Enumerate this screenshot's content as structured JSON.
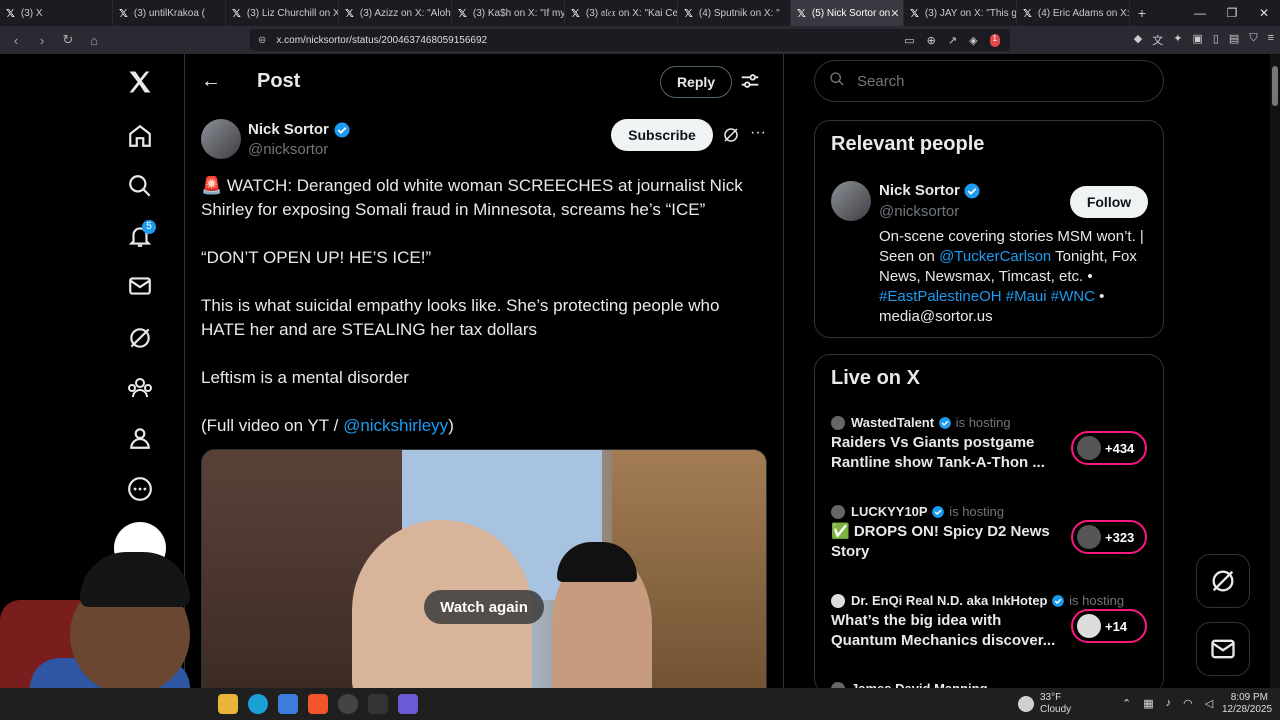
{
  "browser": {
    "tabs": [
      {
        "label": "(3) X"
      },
      {
        "label": "(3) untilKrakoa ("
      },
      {
        "label": "(3) Liz Churchill on X:"
      },
      {
        "label": "(3) Azizz on X: \"Aloha"
      },
      {
        "label": "(3) Ka$h on X: \"If my"
      },
      {
        "label": "(3) 𝔞𝔩𝔢𝔵 on X: \"Kai Ce"
      },
      {
        "label": "(4) Sputnik on X: \""
      },
      {
        "label": "(5) Nick Sortor on"
      },
      {
        "label": "(3) JAY on X: \"This guy"
      },
      {
        "label": "(4) Eric Adams on X: \""
      }
    ],
    "active_tab_index": 7,
    "url": "x.com/nicksortor/status/2004637468059156692",
    "extension_badge": "1"
  },
  "nav": {
    "notifications_count": "5"
  },
  "post_header": {
    "title": "Post",
    "reply_label": "Reply"
  },
  "post": {
    "author_name": "Nick Sortor",
    "author_handle": "@nicksortor",
    "subscribe_label": "Subscribe",
    "paragraphs": {
      "p1": "🚨 WATCH: Deranged old white woman SCREECHES at journalist Nick Shirley for exposing Somali fraud in Minnesota, screams he’s “ICE”",
      "p2": "“DON’T OPEN UP! HE’S ICE!”",
      "p3": "This is what suicidal empathy looks like. She’s protecting people who HATE her and are STEALING her tax dollars",
      "p4": "Leftism is a mental disorder",
      "p5_prefix": "(Full video on YT / ",
      "p5_mention": "@nickshirleyy",
      "p5_suffix": ")"
    },
    "video_button": "Watch again"
  },
  "search": {
    "placeholder": "Search"
  },
  "relevant_people": {
    "heading": "Relevant people",
    "name": "Nick Sortor",
    "handle": "@nicksortor",
    "follow_label": "Follow",
    "bio": {
      "b1": "On-scene covering stories MSM won’t. | Seen on ",
      "b2": "@TuckerCarlson",
      "b3": " Tonight, Fox News, Newsmax, Timcast, etc. • ",
      "b4": "#EastPalestineOH",
      "b5": " ",
      "b6": "#Maui",
      "b7": " ",
      "b8": "#WNC",
      "b9": " • media@sortor.us"
    }
  },
  "live": {
    "heading": "Live on X",
    "hosting_label": "is hosting",
    "items": [
      {
        "host": "WastedTalent",
        "title": "Raiders Vs Giants postgame Rantline show Tank-A-Thon ...",
        "count": "+434"
      },
      {
        "host": "LUCKYY10P",
        "title": "✅ DROPS ON! Spicy D2 News Story",
        "count": "+323"
      },
      {
        "host": "Dr. EnQi Real N.D. aka InkHotep",
        "title": "What’s the big idea with Quantum Mechanics discover...",
        "count": "+14"
      },
      {
        "host": "James David Manning",
        "title": "",
        "count": ""
      }
    ]
  },
  "taskbar": {
    "temperature": "33°F",
    "condition": "Cloudy",
    "time": "8:09 PM",
    "date": "12/28/2025"
  },
  "colors": {
    "accent": "#1d9bf0",
    "live_border": "#f91880",
    "background": "#000000"
  }
}
